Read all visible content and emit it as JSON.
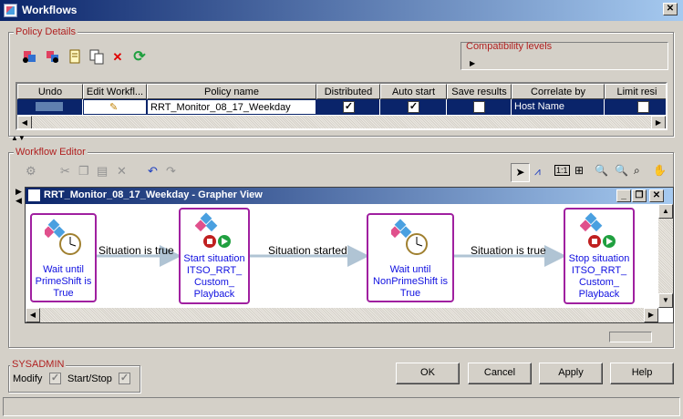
{
  "window": {
    "title": "Workflows"
  },
  "policy_details": {
    "legend": "Policy Details",
    "compat_label": "Compatibility levels",
    "toolbar": [
      "new-policy-icon",
      "new-policy-alt-icon",
      "properties-icon",
      "copy-icon",
      "delete-icon",
      "refresh-icon"
    ],
    "columns": [
      "Undo",
      "Edit Workfl...",
      "Policy name",
      "Distributed",
      "Auto start",
      "Save results",
      "Correlate by",
      "Limit resi"
    ],
    "row": {
      "policy_name": "RRT_Monitor_08_17_Weekday",
      "distributed": true,
      "auto_start": true,
      "save_results": false,
      "correlate_by": "Host Name"
    }
  },
  "workflow_editor": {
    "legend": "Workflow Editor",
    "grapher_title": "RRT_Monitor_08_17_Weekday - Grapher View",
    "nodes": [
      {
        "label": "Wait until PrimeShift is True",
        "lines": [
          "Wait until",
          "PrimeShift is",
          "True"
        ]
      },
      {
        "label": "Start situation ITSO_RRT_Custom_Playback",
        "lines": [
          "Start situation",
          "ITSO_RRT_",
          "Custom_",
          "Playback"
        ]
      },
      {
        "label": "Wait until NonPrimeShift is True",
        "lines": [
          "Wait until",
          "NonPrimeShift is",
          "True"
        ]
      },
      {
        "label": "Stop situation ITSO_RRT_Custom_Playback",
        "lines": [
          "Stop situation",
          "ITSO_RRT_",
          "Custom_",
          "Playback"
        ]
      }
    ],
    "edges": [
      "Situation is true",
      "Situation started",
      "Situation is true"
    ]
  },
  "sysadmin": {
    "legend": "SYSADMIN",
    "modify_label": "Modify",
    "modify_checked": true,
    "startstop_label": "Start/Stop",
    "startstop_checked": true
  },
  "buttons": {
    "ok": "OK",
    "cancel": "Cancel",
    "apply": "Apply",
    "help": "Help"
  }
}
